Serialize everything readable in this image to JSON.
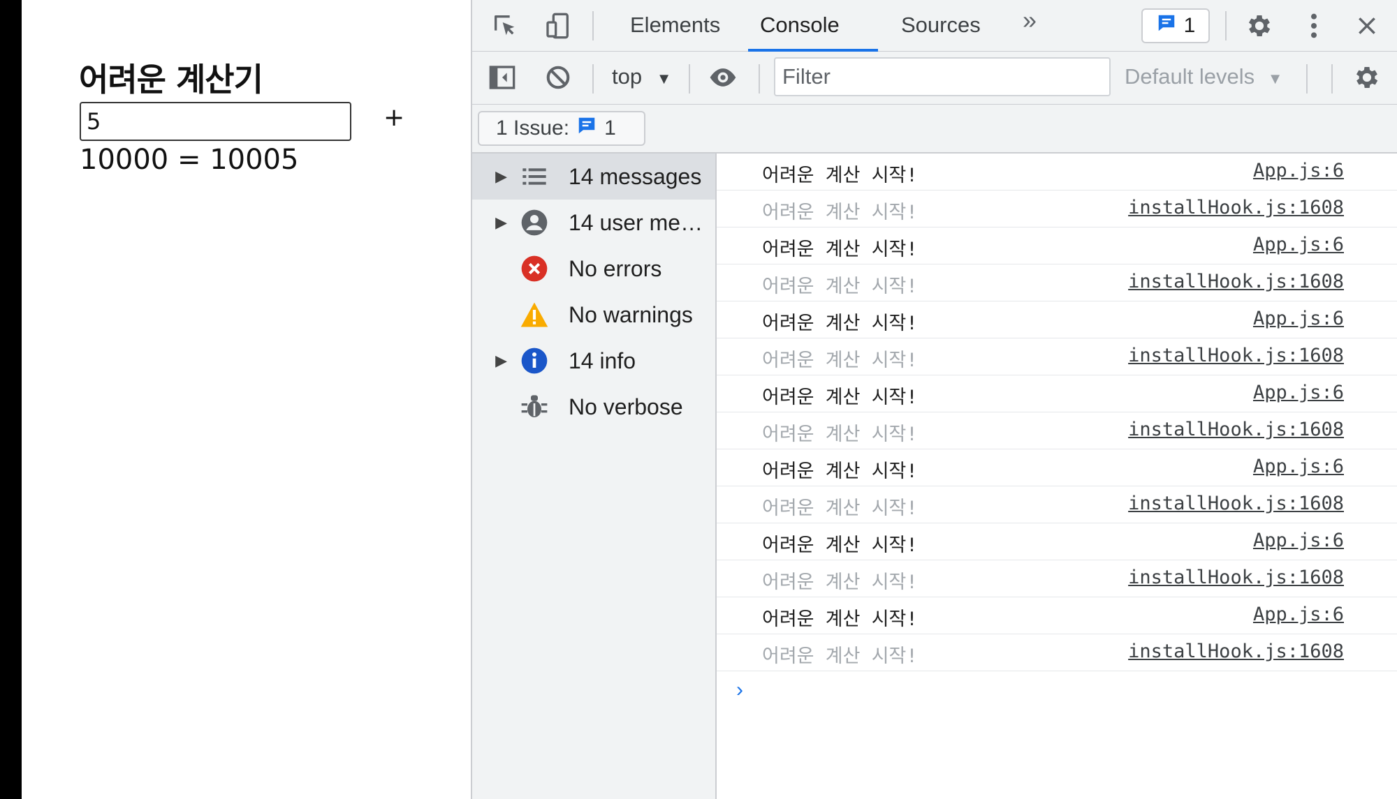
{
  "app": {
    "title": "어려운 계산기",
    "input_value": "5",
    "operator": "+",
    "result": "10000 = 10005"
  },
  "devtools": {
    "tabs": [
      {
        "label": "Elements"
      },
      {
        "label": "Console"
      },
      {
        "label": "Sources"
      }
    ],
    "issues_count": "1",
    "context": "top",
    "filter_placeholder": "Filter",
    "levels_label": "Default levels",
    "issue_bar": {
      "label": "1 Issue:",
      "count": "1"
    },
    "sidebar": [
      {
        "label": "14 messages",
        "icon": "list-icon",
        "expandable": true,
        "selected": true
      },
      {
        "label": "14 user me…",
        "icon": "user-icon",
        "expandable": true,
        "selected": false
      },
      {
        "label": "No errors",
        "icon": "error-icon",
        "expandable": false,
        "selected": false
      },
      {
        "label": "No warnings",
        "icon": "warning-icon",
        "expandable": false,
        "selected": false
      },
      {
        "label": "14 info",
        "icon": "info-icon",
        "expandable": true,
        "selected": false
      },
      {
        "label": "No verbose",
        "icon": "bug-icon",
        "expandable": false,
        "selected": false
      }
    ],
    "logs": [
      {
        "message": "어려운 계산 시작!",
        "source": "App.js:6",
        "dim": false
      },
      {
        "message": "어려운 계산 시작!",
        "source": "installHook.js:1608",
        "dim": true
      },
      {
        "message": "어려운 계산 시작!",
        "source": "App.js:6",
        "dim": false
      },
      {
        "message": "어려운 계산 시작!",
        "source": "installHook.js:1608",
        "dim": true
      },
      {
        "message": "어려운 계산 시작!",
        "source": "App.js:6",
        "dim": false
      },
      {
        "message": "어려운 계산 시작!",
        "source": "installHook.js:1608",
        "dim": true
      },
      {
        "message": "어려운 계산 시작!",
        "source": "App.js:6",
        "dim": false
      },
      {
        "message": "어려운 계산 시작!",
        "source": "installHook.js:1608",
        "dim": true
      },
      {
        "message": "어려운 계산 시작!",
        "source": "App.js:6",
        "dim": false
      },
      {
        "message": "어려운 계산 시작!",
        "source": "installHook.js:1608",
        "dim": true
      },
      {
        "message": "어려운 계산 시작!",
        "source": "App.js:6",
        "dim": false
      },
      {
        "message": "어려운 계산 시작!",
        "source": "installHook.js:1608",
        "dim": true
      },
      {
        "message": "어려운 계산 시작!",
        "source": "App.js:6",
        "dim": false
      },
      {
        "message": "어려운 계산 시작!",
        "source": "installHook.js:1608",
        "dim": true
      }
    ],
    "prompt_symbol": "›"
  },
  "colors": {
    "accent": "#1a73e8",
    "error": "#d93025",
    "warning": "#f9ab00",
    "info": "#1a56c9"
  }
}
